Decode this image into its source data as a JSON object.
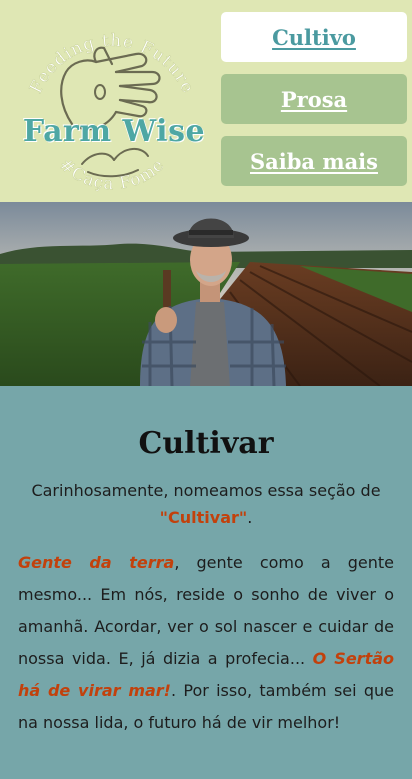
{
  "logo": {
    "title": "Farm Wise",
    "arc_top": "Feeding the Future",
    "arc_bottom": "#Caça Fome",
    "icon": "hand-with-leaves-icon"
  },
  "nav": [
    {
      "label": "Cultivo",
      "active": true
    },
    {
      "label": "Prosa",
      "active": false
    },
    {
      "label": "Saiba mais",
      "active": false
    }
  ],
  "hero": {
    "icon": "farmer-photo"
  },
  "section": {
    "title": "Cultivar",
    "intro_before": "Carinhosamente, nomeamos essa seção de ",
    "intro_highlight": "\"Cultivar\"",
    "intro_after": ".",
    "p_em1": "Gente da terra",
    "p_text1": ", gente como a gente mesmo... Em nós, reside o sonho de viver o amanhã. Acordar, ver o sol nascer e cuidar de nossa vida. E, já dizia a profecia... ",
    "p_em2": "O Sertão há de virar mar!",
    "p_text2": ". Por isso, também sei que na nossa lida, o futuro há de vir melhor!"
  },
  "colors": {
    "header_bg": "#dfe7b4",
    "content_bg": "#76a6a9",
    "nav_idle": "#a7c490",
    "accent": "#c2410c",
    "brand": "#4ea7a4"
  }
}
